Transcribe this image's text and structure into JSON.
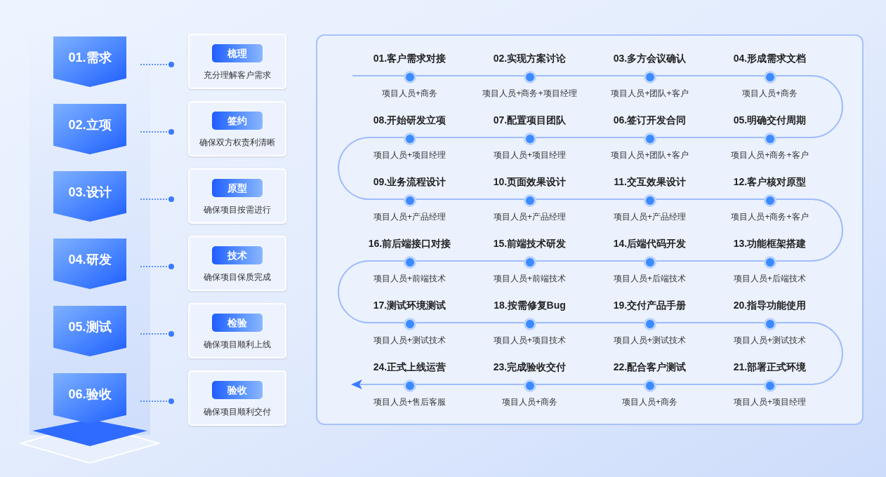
{
  "phases": [
    {
      "label": "01.需求",
      "tag": "梳理",
      "description": "充分理解客户需求"
    },
    {
      "label": "02.立项",
      "tag": "签约",
      "description": "确保双方权责利清晰"
    },
    {
      "label": "03.设计",
      "tag": "原型",
      "description": "确保项目按需进行"
    },
    {
      "label": "04.研发",
      "tag": "技术",
      "description": "确保项目保质完成"
    },
    {
      "label": "05.测试",
      "tag": "检验",
      "description": "确保项目顺利上线"
    },
    {
      "label": "06.验收",
      "tag": "验收",
      "description": "确保项目顺利交付"
    }
  ],
  "process_rows": [
    [
      {
        "title": "01.客户需求对接",
        "roles": "项目人员+商务"
      },
      {
        "title": "02.实现方案讨论",
        "roles": "项目人员+商务+项目经理"
      },
      {
        "title": "03.多方会议确认",
        "roles": "项目人员+团队+客户"
      },
      {
        "title": "04.形成需求文档",
        "roles": "项目人员+商务"
      }
    ],
    [
      {
        "title": "08.开始研发立项",
        "roles": "项目人员+项目经理"
      },
      {
        "title": "07.配置项目团队",
        "roles": "项目人员+项目经理"
      },
      {
        "title": "06.签订开发合同",
        "roles": "项目人员+团队+客户"
      },
      {
        "title": "05.明确交付周期",
        "roles": "项目人员+商务+客户"
      }
    ],
    [
      {
        "title": "09.业务流程设计",
        "roles": "项目人员+产品经理"
      },
      {
        "title": "10.页面效果设计",
        "roles": "项目人员+产品经理"
      },
      {
        "title": "11.交互效果设计",
        "roles": "项目人员+产品经理"
      },
      {
        "title": "12.客户核对原型",
        "roles": "项目人员+商务+客户"
      }
    ],
    [
      {
        "title": "16.前后端接口对接",
        "roles": "项目人员+前端技术"
      },
      {
        "title": "15.前端技术研发",
        "roles": "项目人员+前端技术"
      },
      {
        "title": "14.后端代码开发",
        "roles": "项目人员+后端技术"
      },
      {
        "title": "13.功能框架搭建",
        "roles": "项目人员+后端技术"
      }
    ],
    [
      {
        "title": "17.测试环境测试",
        "roles": "项目人员+测试技术"
      },
      {
        "title": "18.按需修复Bug",
        "roles": "项目人员+项目技术"
      },
      {
        "title": "19.交付产品手册",
        "roles": "项目人员+测试技术"
      },
      {
        "title": "20.指导功能使用",
        "roles": "项目人员+测试技术"
      }
    ],
    [
      {
        "title": "24.正式上线运营",
        "roles": "项目人员+售后客服"
      },
      {
        "title": "23.完成验收交付",
        "roles": "项目人员+商务"
      },
      {
        "title": "22.配合客户测试",
        "roles": "项目人员+商务"
      },
      {
        "title": "21.部署正式环境",
        "roles": "项目人员+项目经理"
      }
    ]
  ]
}
